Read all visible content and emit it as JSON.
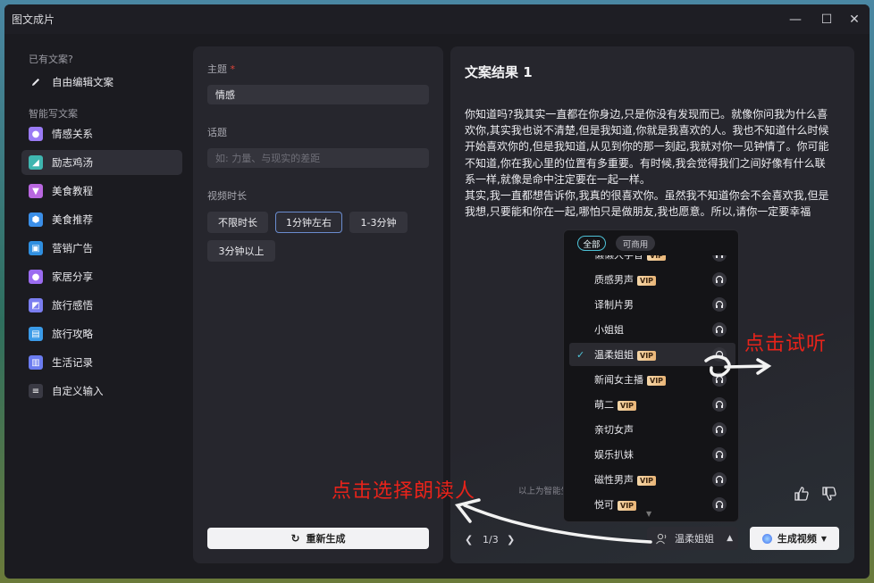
{
  "window": {
    "title": "图文成片"
  },
  "sidebar": {
    "section1": "已有文案?",
    "free_edit": "自由编辑文案",
    "section2": "智能写文案",
    "items": [
      {
        "label": "情感关系",
        "icon": "people-icon",
        "color": "#9b7bf5"
      },
      {
        "label": "励志鸡汤",
        "icon": "cup-icon",
        "color": "#3fb6b0"
      },
      {
        "label": "美食教程",
        "icon": "goblet-icon",
        "color": "#b967e0"
      },
      {
        "label": "美食推荐",
        "icon": "badge-icon",
        "color": "#3b8fe8"
      },
      {
        "label": "营销广告",
        "icon": "monitor-icon",
        "color": "#2f8fe0"
      },
      {
        "label": "家居分享",
        "icon": "person-icon",
        "color": "#9b6cf0"
      },
      {
        "label": "旅行感悟",
        "icon": "photo-icon",
        "color": "#7b7ef0"
      },
      {
        "label": "旅行攻略",
        "icon": "suitcase-icon",
        "color": "#3b9be8"
      },
      {
        "label": "生活记录",
        "icon": "book-icon",
        "color": "#6b7cf0"
      },
      {
        "label": "自定义输入",
        "icon": "text-icon",
        "color": "#3a3a44"
      }
    ],
    "active_index": 1
  },
  "form": {
    "topic_label": "主题",
    "required_mark": "*",
    "topic_value": "情感",
    "subject_label": "话题",
    "subject_placeholder": "如: 力量、与现实的差距",
    "duration_label": "视频时长",
    "durations": [
      "不限时长",
      "1分钟左右",
      "1-3分钟",
      "3分钟以上"
    ],
    "selected_duration": "1分钟左右",
    "regenerate": "重新生成"
  },
  "result": {
    "title": "文案结果 1",
    "paragraph1": "你知道吗?我其实一直都在你身边,只是你没有发现而已。就像你问我为什么喜欢你,其实我也说不清楚,但是我知道,你就是我喜欢的人。我也不知道什么时候开始喜欢你的,但是我知道,从见到你的那一刻起,我就对你一见钟情了。你可能不知道,你在我心里的位置有多重要。有时候,我会觉得我们之间好像有什么联系一样,就像是命中注定要在一起一样。",
    "paragraph2": "其实,我一直都想告诉你,我真的很喜欢你。虽然我不知道你会不会喜欢我,但是我想,只要能和你在一起,哪怕只是做朋友,我也愿意。所以,请你一定要幸福",
    "disclaimer": "以上为智能生成的内容仅",
    "pager": "1/3",
    "voice": "温柔姐姐",
    "generate": "生成视频"
  },
  "voice_dropdown": {
    "tabs": [
      "全部",
      "可商用"
    ],
    "items": [
      {
        "name": "懒懒大学音",
        "vip": true
      },
      {
        "name": "质感男声",
        "vip": true
      },
      {
        "name": "译制片男",
        "vip": false
      },
      {
        "name": "小姐姐",
        "vip": false
      },
      {
        "name": "温柔姐姐",
        "vip": true,
        "selected": true
      },
      {
        "name": "新闻女主播",
        "vip": true
      },
      {
        "name": "萌二",
        "vip": true
      },
      {
        "name": "亲切女声",
        "vip": false
      },
      {
        "name": "娱乐扒妹",
        "vip": false
      },
      {
        "name": "磁性男声",
        "vip": true
      },
      {
        "name": "悦可",
        "vip": true
      }
    ],
    "vip_badge": "VIP"
  },
  "annotations": {
    "listen": "点击试听",
    "select_voice": "点击选择朗读人"
  },
  "colors": {
    "accent": "#6a8ccf",
    "annotation": "#e8231a"
  }
}
